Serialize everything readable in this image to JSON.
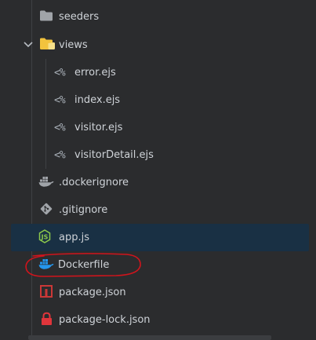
{
  "explorer": {
    "items": [
      {
        "label": "seeders",
        "type": "folder",
        "icon": "folder-icon",
        "color": "#a0a4a9"
      },
      {
        "label": "views",
        "type": "folder-open",
        "icon": "folder-open-icon",
        "color": "#f2c33d"
      },
      {
        "label": "error.ejs",
        "type": "file",
        "icon": "ejs-icon",
        "glyph": "<%"
      },
      {
        "label": "index.ejs",
        "type": "file",
        "icon": "ejs-icon",
        "glyph": "<%"
      },
      {
        "label": "visitor.ejs",
        "type": "file",
        "icon": "ejs-icon",
        "glyph": "<%"
      },
      {
        "label": "visitorDetail.ejs",
        "type": "file",
        "icon": "ejs-icon",
        "glyph": "<%"
      },
      {
        "label": ".dockerignore",
        "type": "file",
        "icon": "docker-icon",
        "color": "#a0a4a9"
      },
      {
        "label": ".gitignore",
        "type": "file",
        "icon": "git-icon",
        "color": "#a0a4a9"
      },
      {
        "label": "app.js",
        "type": "file",
        "icon": "nodejs-icon",
        "color": "#8cc84b",
        "selected": true
      },
      {
        "label": "Dockerfile",
        "type": "file",
        "icon": "docker-icon",
        "color": "#2496ed"
      },
      {
        "label": "package.json",
        "type": "file",
        "icon": "npm-icon",
        "color": "#cb3837"
      },
      {
        "label": "package-lock.json",
        "type": "file",
        "icon": "lock-icon",
        "color": "#e0353b"
      }
    ]
  },
  "colors": {
    "background": "#2b2c2e",
    "selection": "#193044",
    "text": "#cfd3d8",
    "annotation": "#d0141c"
  }
}
